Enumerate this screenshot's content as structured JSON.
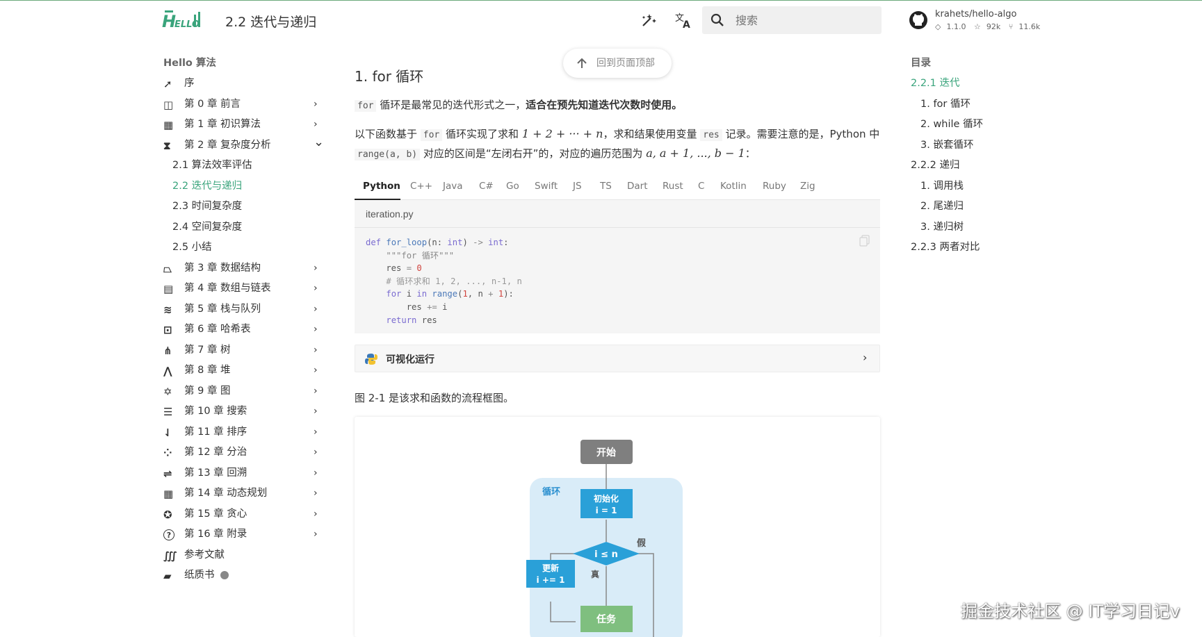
{
  "header": {
    "logo_text": "Hello 算",
    "page_title": "2.2   迭代与递归",
    "search_placeholder": "搜索",
    "repo_name": "krahets/hello-algo",
    "repo_version": "1.1.0",
    "repo_stars": "92k",
    "repo_forks": "11.6k"
  },
  "sidebar": {
    "title": "Hello 算法",
    "items": [
      {
        "label": "序",
        "icon": "rocket-icon",
        "chevron": false
      },
      {
        "label": "第 0 章   前言",
        "icon": "book-open-icon",
        "chevron": true
      },
      {
        "label": "第 1 章   初识算法",
        "icon": "calculator-icon",
        "chevron": true
      },
      {
        "label": "第 2 章   复杂度分析",
        "icon": "hourglass-icon",
        "chevron": true,
        "expanded": true
      }
    ],
    "subitems": [
      {
        "label": "2.1   算法效率评估",
        "active": false
      },
      {
        "label": "2.2   迭代与递归",
        "active": true
      },
      {
        "label": "2.3   时间复杂度",
        "active": false
      },
      {
        "label": "2.4   空间复杂度",
        "active": false
      },
      {
        "label": "2.5   小结",
        "active": false
      }
    ],
    "items_after": [
      {
        "label": "第 3 章   数据结构",
        "icon": "shapes-icon",
        "chevron": true
      },
      {
        "label": "第 4 章   数组与链表",
        "icon": "table-icon",
        "chevron": true
      },
      {
        "label": "第 5 章   栈与队列",
        "icon": "stack-icon",
        "chevron": true
      },
      {
        "label": "第 6 章   哈希表",
        "icon": "table-search-icon",
        "chevron": true
      },
      {
        "label": "第 7 章   树",
        "icon": "tree-icon",
        "chevron": true
      },
      {
        "label": "第 8 章   堆",
        "icon": "heap-icon",
        "chevron": true
      },
      {
        "label": "第 9 章   图",
        "icon": "graph-icon",
        "chevron": true
      },
      {
        "label": "第 10 章   搜索",
        "icon": "text-search-icon",
        "chevron": true
      },
      {
        "label": "第 11 章   排序",
        "icon": "sort-icon",
        "chevron": true
      },
      {
        "label": "第 12 章   分治",
        "icon": "divide-icon",
        "chevron": true
      },
      {
        "label": "第 13 章   回溯",
        "icon": "backtrack-icon",
        "chevron": true
      },
      {
        "label": "第 14 章   动态规划",
        "icon": "grid-icon",
        "chevron": true
      },
      {
        "label": "第 15 章   贪心",
        "icon": "lightbulb-icon",
        "chevron": true
      },
      {
        "label": "第 16 章   附录",
        "icon": "help-icon",
        "chevron": true
      },
      {
        "label": "参考文献",
        "icon": "library-icon",
        "chevron": false
      },
      {
        "label": "纸质书",
        "icon": "book-icon",
        "chevron": false
      }
    ]
  },
  "main": {
    "back_to_top": "回到页面顶部",
    "heading": "1.  for 循环",
    "p1_code": "for",
    "p1_text": " 循环是最常见的迭代形式之一，",
    "p1_bold": "适合在预先知道迭代次数时使用。",
    "p2_a": "以下函数基于 ",
    "p2_code1": "for",
    "p2_b": " 循环实现了求和 ",
    "p2_math1": "1 + 2 + ··· + n",
    "p2_c": "，求和结果使用变量 ",
    "p2_code2": "res",
    "p2_d": " 记录。需要注意的是，Python 中 ",
    "p2_code3": "range(a, b)",
    "p2_e": " 对应的区间是“左闭右开”的，对应的遍历范围为 ",
    "p2_math2": "a, a + 1, ..., b − 1",
    "p2_f": "：",
    "tabs": [
      "Python",
      "C++",
      "Java",
      "C#",
      "Go",
      "Swift",
      "JS",
      "TS",
      "Dart",
      "Rust",
      "C",
      "Kotlin",
      "Ruby",
      "Zig"
    ],
    "code_filename": "iteration.py",
    "visualize_label": "可视化运行",
    "p3": "图 2-1 是该求和函数的流程框图。"
  },
  "flowchart": {
    "start": "开始",
    "loop_label": "循环",
    "init_line1": "初始化",
    "init_line2": "i = 1",
    "cond": "i ≤ n",
    "false_label": "假",
    "true_label": "真",
    "update_line1": "更新",
    "update_line2": "i += 1",
    "task": "任务"
  },
  "toc": {
    "title": "目录",
    "items": [
      {
        "label": "2.2.1   迭代",
        "active": true,
        "level": 1
      },
      {
        "label": "1.   for 循环",
        "active": false,
        "level": 2
      },
      {
        "label": "2.   while 循环",
        "active": false,
        "level": 2
      },
      {
        "label": "3.   嵌套循环",
        "active": false,
        "level": 2
      },
      {
        "label": "2.2.2   递归",
        "active": false,
        "level": 1
      },
      {
        "label": "1.   调用栈",
        "active": false,
        "level": 2
      },
      {
        "label": "2.   尾递归",
        "active": false,
        "level": 2
      },
      {
        "label": "3.   递归树",
        "active": false,
        "level": 2
      },
      {
        "label": "2.2.3   两者对比",
        "active": false,
        "level": 1
      }
    ]
  },
  "watermark": "掘金技术社区 @ IT学习日记v",
  "colors": {
    "accent": "#3aa47c",
    "flow_blue": "#2aa0d8",
    "flow_gray": "#7f7f7f",
    "flow_green": "#7fbf7f",
    "loop_bg": "#d9ecf8"
  }
}
